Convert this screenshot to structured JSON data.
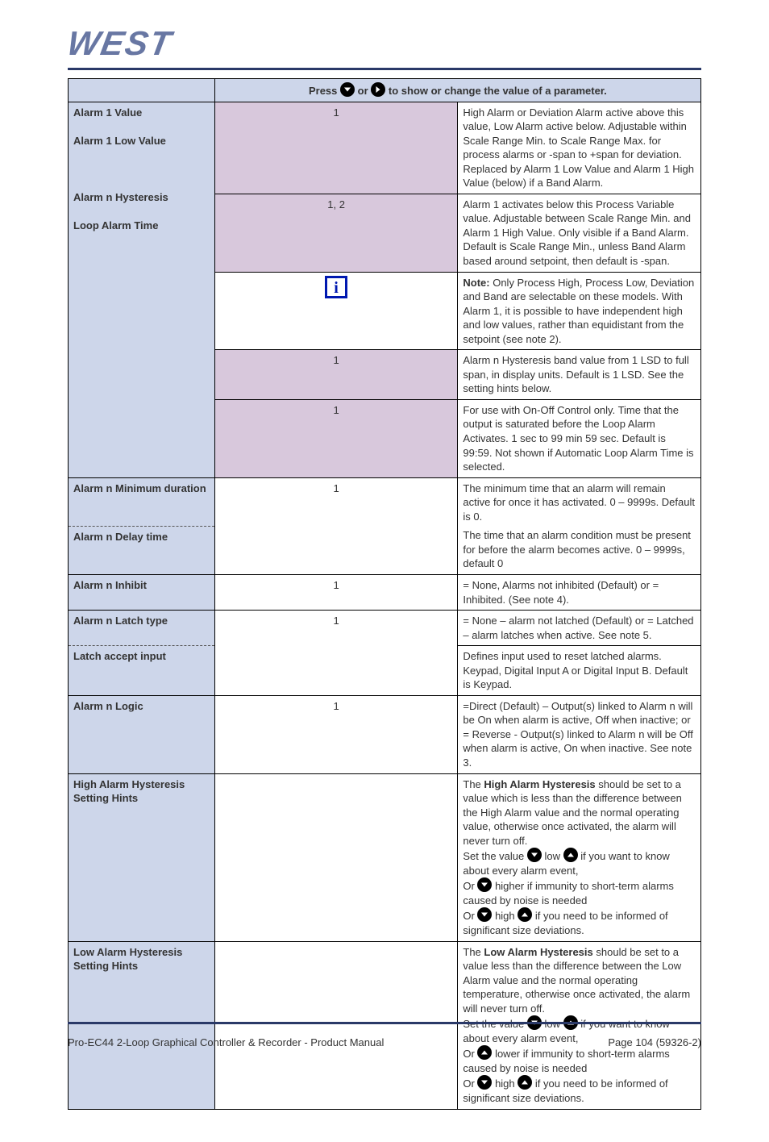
{
  "branding": {
    "logo_text": "WEST"
  },
  "table": {
    "header_prefix": "Press ",
    "header_mid": " or ",
    "header_suffix": " to show or change the value of a parameter.",
    "rows": [
      {
        "param": "Alarm 1 Value",
        "note": "1",
        "desc": "High Alarm or Deviation Alarm active above this value, Low Alarm active below. Adjustable within Scale Range Min. to Scale Range Max. for process alarms or -span to +span for deviation. Replaced by Alarm 1 Low Value and Alarm 1 High Value (below) if a Band Alarm.",
        "note_bg": true
      },
      {
        "param": "Alarm 1 Low Value",
        "note": "1, 2",
        "desc": "Alarm 1 activates below this Process Variable value. Adjustable between Scale Range Min. and Alarm 1 High Value. Only visible if a Band Alarm. Default is Scale Range Min., unless Band Alarm based around setpoint, then default is -span.",
        "note_bg": true
      },
      {
        "param": "",
        "note_icon": "info",
        "desc_bold": "Note: ",
        "desc": "Only Process High, Process Low, Deviation and Band are selectable on these models. With Alarm 1, it is possible to have independent high and low values, rather than equidistant from the setpoint (see note 2).",
        "note_bg": false,
        "no_param_border": true
      },
      {
        "param": "Alarm n Hysteresis",
        "note": "1",
        "desc": "Alarm n Hysteresis band value from 1 LSD to full span, in display units. Default is 1 LSD. See the setting hints below.",
        "note_bg": true
      },
      {
        "param": "Loop Alarm Time",
        "note": "1",
        "desc": "For use with On-Off Control only. Time that the output is saturated before the Loop Alarm Activates. 1 sec to 99 min 59 sec. Default is 99:59. Not shown if Automatic Loop Alarm Time is selected.",
        "note_bg": true
      },
      {
        "param": "Alarm n Minimum duration",
        "note": "1",
        "desc": "The minimum time that an alarm will remain active for once it has activated. 0 – 9999s. Default is 0.",
        "dashed_below": true
      },
      {
        "param": "Alarm n Delay time",
        "note": "1",
        "desc": "The time that an alarm condition must be present for before the alarm becomes active. 0 – 9999s, default 0",
        "dashed_top": true
      },
      {
        "param": "Alarm n Inhibit",
        "note": "1",
        "desc": "= None, Alarms not inhibited (Default) or = Inhibited. (See note 4)."
      },
      {
        "param": "Alarm n Latch type",
        "note": "1",
        "desc": "= None – alarm not latched (Default) or = Latched – alarm latches when active. See note 5.",
        "dashed_below": true
      },
      {
        "param": "Latch accept input",
        "note": "1",
        "desc": "Defines input used to reset latched alarms. Keypad, Digital Input A or Digital Input B. Default is Keypad.",
        "dashed_top": true
      },
      {
        "param": "Alarm n Logic",
        "note": "1",
        "desc": "=Direct (Default) – Output(s) linked to Alarm n will be On when alarm is active, Off when inactive; or = Reverse - Output(s) linked to Alarm n will be Off when alarm is active, On when inactive. See note 3."
      },
      {
        "param": "High Alarm Hysteresis Setting Hints",
        "note": "",
        "hints": [
          {
            "prefix": "The",
            "bold": "",
            "mid": "High Alarm Hysteresis",
            "suffix": " should be set to a value which is less than the difference between the High Alarm value and the normal operating value, otherwise once activated, the alarm will never turn off."
          },
          {
            "prefix": "Set the value ",
            "icons": [
              "down",
              "up"
            ],
            "suffix": " if you want to know about every alarm event,"
          },
          {
            "prefix": "Or ",
            "icons": [
              "down"
            ],
            "suffix": " if immunity to short-term alarms caused by noise is needed"
          },
          {
            "prefix": "Or ",
            "icons": [
              "down",
              "up"
            ],
            "suffix": " if you need to be informed of significant size deviations."
          }
        ]
      },
      {
        "param": "Low Alarm Hysteresis Setting Hints",
        "note": "",
        "hints": [
          {
            "prefix": "The",
            "bold": "",
            "mid": "Low Alarm Hysteresis",
            "suffix": " should be set to a value less than the difference between the Low Alarm value and the normal operating temperature, otherwise once activated, the alarm will never turn off."
          },
          {
            "prefix": "Set the value ",
            "icons": [
              "down",
              "up"
            ],
            "suffix": " if you want to know about every alarm event,"
          },
          {
            "prefix": "Or ",
            "icons": [
              "up"
            ],
            "suffix": " if immunity to short-term alarms caused by noise is needed"
          },
          {
            "prefix": "Or ",
            "icons": [
              "down",
              "up"
            ],
            "suffix": " if you need to be informed of significant size deviations."
          }
        ]
      }
    ]
  },
  "hints_labels": {
    "low": "low",
    "high": "high",
    "higher": "higher",
    "lower": "lower"
  },
  "footer": {
    "left": "Pro-EC44 2-Loop Graphical Controller & Recorder - Product Manual",
    "right": "Page 104 (59326-2)"
  }
}
